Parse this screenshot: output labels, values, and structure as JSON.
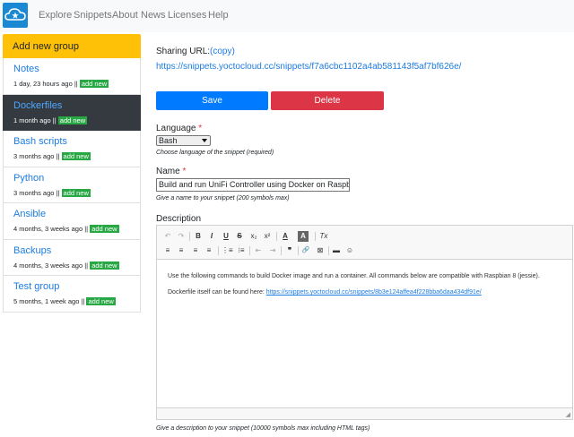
{
  "nav": {
    "links": [
      "Explore",
      "Snippets",
      "About",
      "News",
      "Licenses",
      "Help"
    ]
  },
  "sidebar": {
    "add_group": "Add new group",
    "add_new": "add new",
    "groups": [
      {
        "name": "Notes",
        "meta": "1 day, 23 hours ago ||"
      },
      {
        "name": "Dockerfiles",
        "meta": "1 month ago ||"
      },
      {
        "name": "Bash scripts",
        "meta": "3 months ago ||"
      },
      {
        "name": "Python",
        "meta": "3 months ago ||"
      },
      {
        "name": "Ansible",
        "meta": "4 months, 3 weeks ago ||"
      },
      {
        "name": "Backups",
        "meta": "4 months, 3 weeks ago ||"
      },
      {
        "name": "Test group",
        "meta": "5 months, 1 week ago ||"
      }
    ]
  },
  "main": {
    "sharing_label": "Sharing URL:",
    "copy_link": "(copy)",
    "sharing_url": "https://snippets.yoctocloud.cc/snippets/f7a6cbc1102a4ab581143f5af7bf626e/",
    "save_label": "Save",
    "delete_label": "Delete",
    "language_label": "Language",
    "language_value": "Bash",
    "language_hint": "Choose language of the snippet (required)",
    "name_label": "Name",
    "name_value": "Build and run UniFi Controller using Docker on Raspberry Pi",
    "name_hint": "Give a name to your snippet (200 symbols max)",
    "description_label": "Description",
    "description_line1": "Use the following commands to build Docker image and run a container. All commands below are compatible with Raspbian 8 (jessie).",
    "description_line2_prefix": "Dockerfile itself can be found here: ",
    "description_link": "https://snippets.yoctocloud.cc/snippets/8b3e124affea4f228bba6daa434df91e/",
    "description_hint": "Give a description to your snippet (10000 symbols max including HTML tags)",
    "required_mark": "*"
  },
  "toolbar": {
    "row1": [
      "↶",
      "↷",
      "B",
      "I",
      "U",
      "S",
      "x₂",
      "x²",
      "A",
      "A",
      "Tx"
    ],
    "row2": [
      "≡",
      "≡",
      "≡",
      "≡",
      "⋮≡",
      "⁝≡",
      "⇤",
      "⇥",
      "❞",
      "🔗",
      "⊠",
      "▬",
      "☺"
    ]
  },
  "colors": {
    "primary": "#007bff",
    "danger": "#dc3545",
    "warning": "#ffc107",
    "success": "#28a745",
    "dark": "#343a40",
    "link": "#1d7ce0"
  }
}
